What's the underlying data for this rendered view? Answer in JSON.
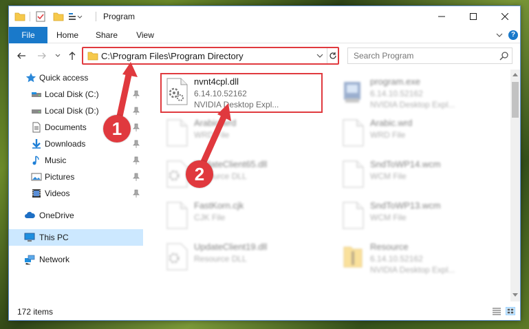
{
  "window": {
    "title": "Program",
    "minimize_glyph": "—",
    "maximize_glyph": "☐",
    "close_glyph": "✕"
  },
  "ribbon": {
    "tabs": [
      {
        "label": "File",
        "active": true
      },
      {
        "label": "Home",
        "active": false
      },
      {
        "label": "Share",
        "active": false
      },
      {
        "label": "View",
        "active": false
      }
    ],
    "help_label": "?"
  },
  "nav": {
    "address": "C:\\Program Files\\Program Directory",
    "search_placeholder": "Search Program"
  },
  "sidebar": {
    "items": [
      {
        "label": "Quick access",
        "icon": "star-icon",
        "pinned": false
      },
      {
        "label": "Local Disk (C:)",
        "icon": "drive-icon",
        "pinned": true
      },
      {
        "label": "Local Disk (D:)",
        "icon": "drive-icon",
        "pinned": true
      },
      {
        "label": "Documents",
        "icon": "documents-icon",
        "pinned": true
      },
      {
        "label": "Downloads",
        "icon": "download-icon",
        "pinned": true
      },
      {
        "label": "Music",
        "icon": "music-icon",
        "pinned": true
      },
      {
        "label": "Pictures",
        "icon": "pictures-icon",
        "pinned": true
      },
      {
        "label": "Videos",
        "icon": "videos-icon",
        "pinned": true
      },
      {
        "label": "OneDrive",
        "icon": "cloud-icon",
        "pinned": false
      },
      {
        "label": "This PC",
        "icon": "computer-icon",
        "pinned": false,
        "selected": true
      },
      {
        "label": "Network",
        "icon": "network-icon",
        "pinned": false
      }
    ]
  },
  "files": [
    {
      "name": "nvnt4cpl.dll",
      "line1": "6.14.10.52162",
      "line2": "NVIDIA Desktop Expl...",
      "icon": "dll-icon",
      "highlighted": true
    },
    {
      "name": "program.exe",
      "line1": "6.14.10.52162",
      "line2": "NVIDIA Desktop Expl...",
      "icon": "exe-icon",
      "highlighted": false
    },
    {
      "name": "Arabic.wrd",
      "line1": "WRD File",
      "line2": "",
      "icon": "blank-file-icon",
      "highlighted": false
    },
    {
      "name": "Arabic.wrd",
      "line1": "WRD File",
      "line2": "",
      "icon": "blank-file-icon",
      "highlighted": false
    },
    {
      "name": "UpdateClient65.dll",
      "line1": "Resource DLL",
      "line2": "",
      "icon": "dll-icon",
      "highlighted": false
    },
    {
      "name": "SndToWP14.wcm",
      "line1": "WCM File",
      "line2": "",
      "icon": "blank-file-icon",
      "highlighted": false
    },
    {
      "name": "FastKorn.cjk",
      "line1": "CJK File",
      "line2": "",
      "icon": "blank-file-icon",
      "highlighted": false
    },
    {
      "name": "SndToWP13.wcm",
      "line1": "WCM File",
      "line2": "",
      "icon": "blank-file-icon",
      "highlighted": false
    },
    {
      "name": "UpdateClient19.dll",
      "line1": "Resource DLL",
      "line2": "",
      "icon": "dll-icon",
      "highlighted": false
    },
    {
      "name": "Resource",
      "line1": "6.14.10.52162",
      "line2": "NVIDIA Desktop Expl...",
      "icon": "archive-icon",
      "highlighted": false
    }
  ],
  "status": {
    "item_count": "172 items"
  },
  "annotations": {
    "callout_1": "1",
    "callout_2": "2",
    "accent_color": "#e0393e"
  },
  "colors": {
    "file_tab": "#1979ca",
    "selected_bg": "#cce8ff"
  }
}
